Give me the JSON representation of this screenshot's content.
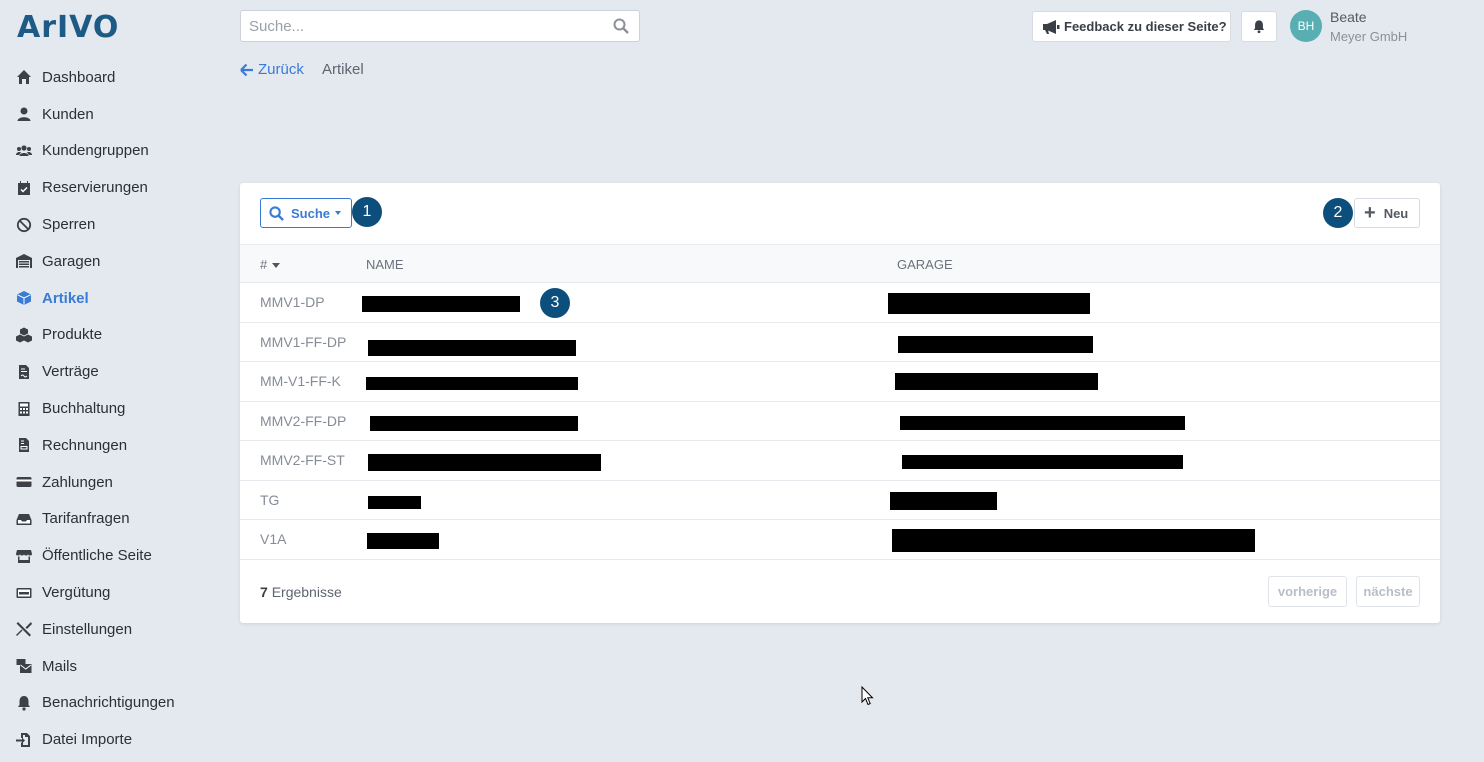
{
  "app": {
    "logo": "ArIVO"
  },
  "search": {
    "placeholder": "Suche..."
  },
  "topbar": {
    "feedback_label": "Feedback zu dieser Seite?",
    "user": {
      "initials": "BH",
      "name": "Beate",
      "company": "Meyer GmbH",
      "avatar_color": "#59aeb1"
    }
  },
  "sidebar": {
    "items": [
      {
        "label": "Dashboard",
        "icon": "home-icon",
        "active": false
      },
      {
        "label": "Kunden",
        "icon": "user-icon",
        "active": false
      },
      {
        "label": "Kundengruppen",
        "icon": "users-icon",
        "active": false
      },
      {
        "label": "Reservierungen",
        "icon": "calendar-check-icon",
        "active": false
      },
      {
        "label": "Sperren",
        "icon": "ban-icon",
        "active": false
      },
      {
        "label": "Garagen",
        "icon": "warehouse-icon",
        "active": false
      },
      {
        "label": "Artikel",
        "icon": "cube-icon",
        "active": true
      },
      {
        "label": "Produkte",
        "icon": "cubes-icon",
        "active": false
      },
      {
        "label": "Verträge",
        "icon": "file-contract-icon",
        "active": false
      },
      {
        "label": "Buchhaltung",
        "icon": "calculator-icon",
        "active": false
      },
      {
        "label": "Rechnungen",
        "icon": "file-invoice-icon",
        "active": false
      },
      {
        "label": "Zahlungen",
        "icon": "credit-card-icon",
        "active": false
      },
      {
        "label": "Tarifanfragen",
        "icon": "inbox-icon",
        "active": false
      },
      {
        "label": "Öffentliche Seite",
        "icon": "store-icon",
        "active": false
      },
      {
        "label": "Vergütung",
        "icon": "money-icon",
        "active": false
      },
      {
        "label": "Einstellungen",
        "icon": "tools-icon",
        "active": false
      },
      {
        "label": "Mails",
        "icon": "mail-bulk-icon",
        "active": false
      },
      {
        "label": "Benachrichtigungen",
        "icon": "bell-icon",
        "active": false
      },
      {
        "label": "Datei Importe",
        "icon": "file-import-icon",
        "active": false
      }
    ]
  },
  "breadcrumb": {
    "back_label": "Zurück",
    "current": "Artikel"
  },
  "toolbar": {
    "search_label": "Suche",
    "new_label": "Neu"
  },
  "badges": {
    "one": "1",
    "two": "2",
    "three": "3"
  },
  "table": {
    "headers": {
      "id": "#",
      "name": "NAME",
      "garage": "GARAGE"
    },
    "rows": [
      {
        "code": "MMV1-DP"
      },
      {
        "code": "MMV1-FF-DP"
      },
      {
        "code": "MM-V1-FF-K"
      },
      {
        "code": "MMV2-FF-DP"
      },
      {
        "code": "MMV2-FF-ST"
      },
      {
        "code": "TG"
      },
      {
        "code": "V1A"
      }
    ]
  },
  "footer": {
    "count": "7",
    "count_label": "Ergebnisse",
    "prev_label": "vorherige",
    "next_label": "nächste"
  },
  "colors": {
    "accent": "#3a7bd5",
    "badge": "#0d4f7c",
    "logo": "#1d5b86",
    "background": "#e4e8ef"
  }
}
